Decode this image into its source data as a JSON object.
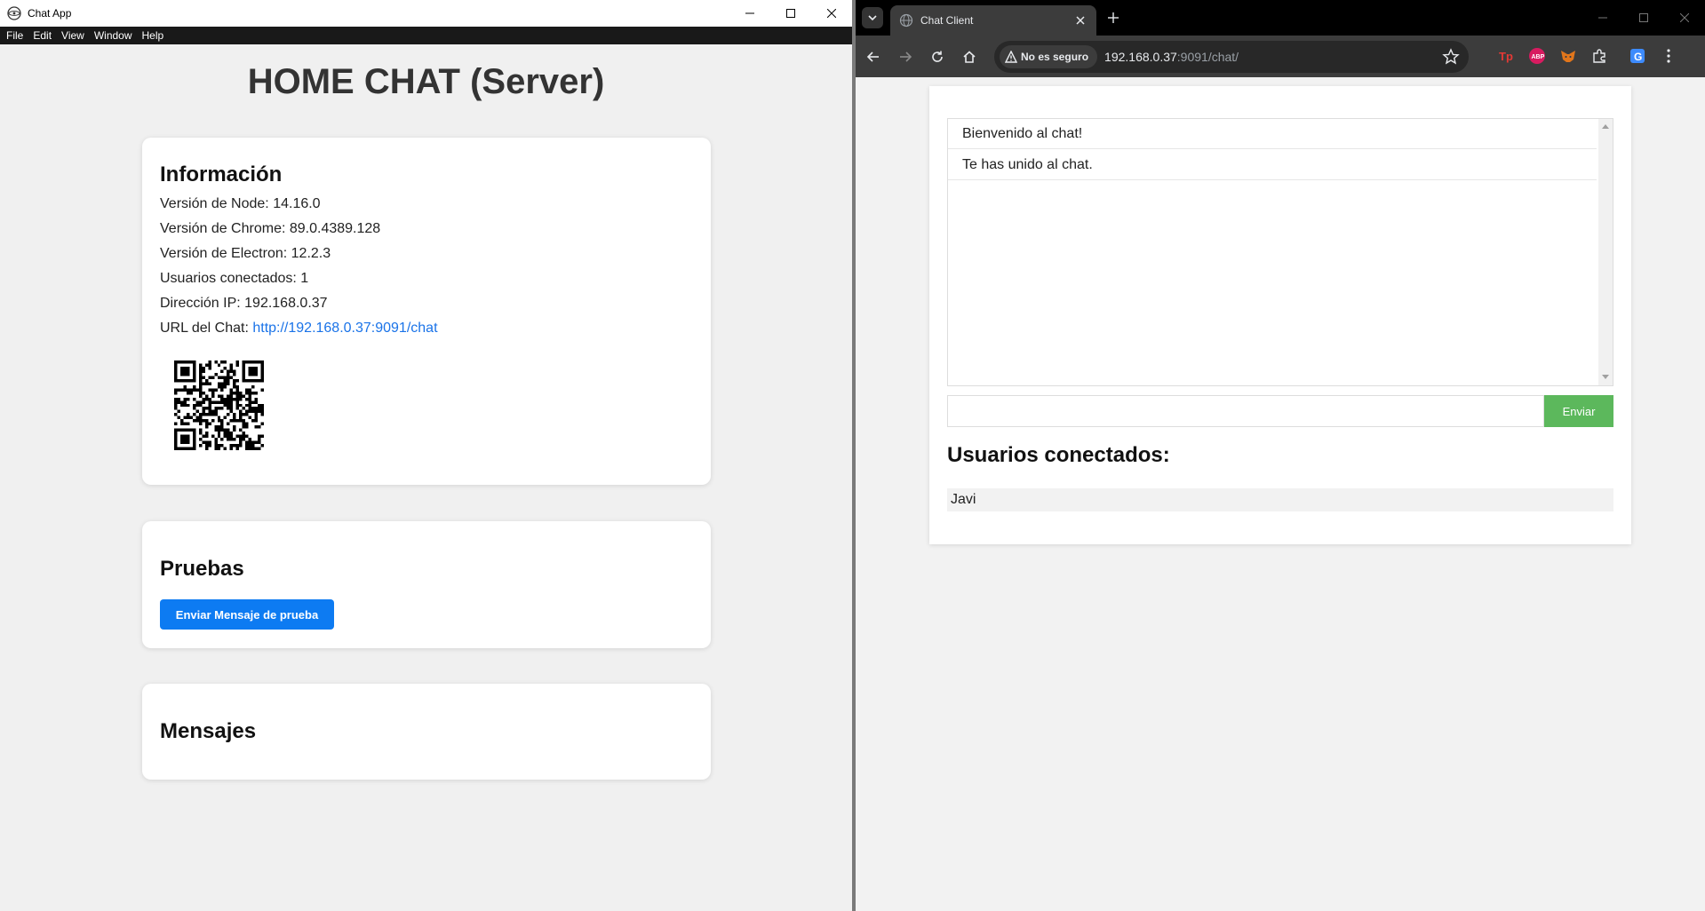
{
  "left_window": {
    "title": "Chat App",
    "menu": [
      "File",
      "Edit",
      "View",
      "Window",
      "Help"
    ],
    "heading": "HOME CHAT (Server)",
    "info_card": {
      "title": "Información",
      "lines": [
        "Versión de Node: 14.16.0",
        "Versión de Chrome: 89.0.4389.128",
        "Versión de Electron: 12.2.3",
        "Usuarios conectados: 1",
        "Dirección IP: 192.168.0.37"
      ],
      "url_label": "URL del Chat: ",
      "url_value": "http://192.168.0.37:9091/chat"
    },
    "tests_card": {
      "title": "Pruebas",
      "button_label": "Enviar Mensaje de prueba"
    },
    "messages_card": {
      "title": "Mensajes"
    }
  },
  "browser": {
    "tab_title": "Chat Client",
    "security_label": "No es seguro",
    "url_host": "192.168.0.37",
    "url_path": ":9091/chat/",
    "colors": {
      "accent_send": "#5cb85c",
      "accent_test": "#0d7bf2"
    }
  },
  "chat": {
    "messages": [
      "Bienvenido al chat!",
      "Te has unido al chat."
    ],
    "input_value": "",
    "send_label": "Enviar",
    "users_heading": "Usuarios conectados:",
    "users": [
      "Javi"
    ]
  }
}
